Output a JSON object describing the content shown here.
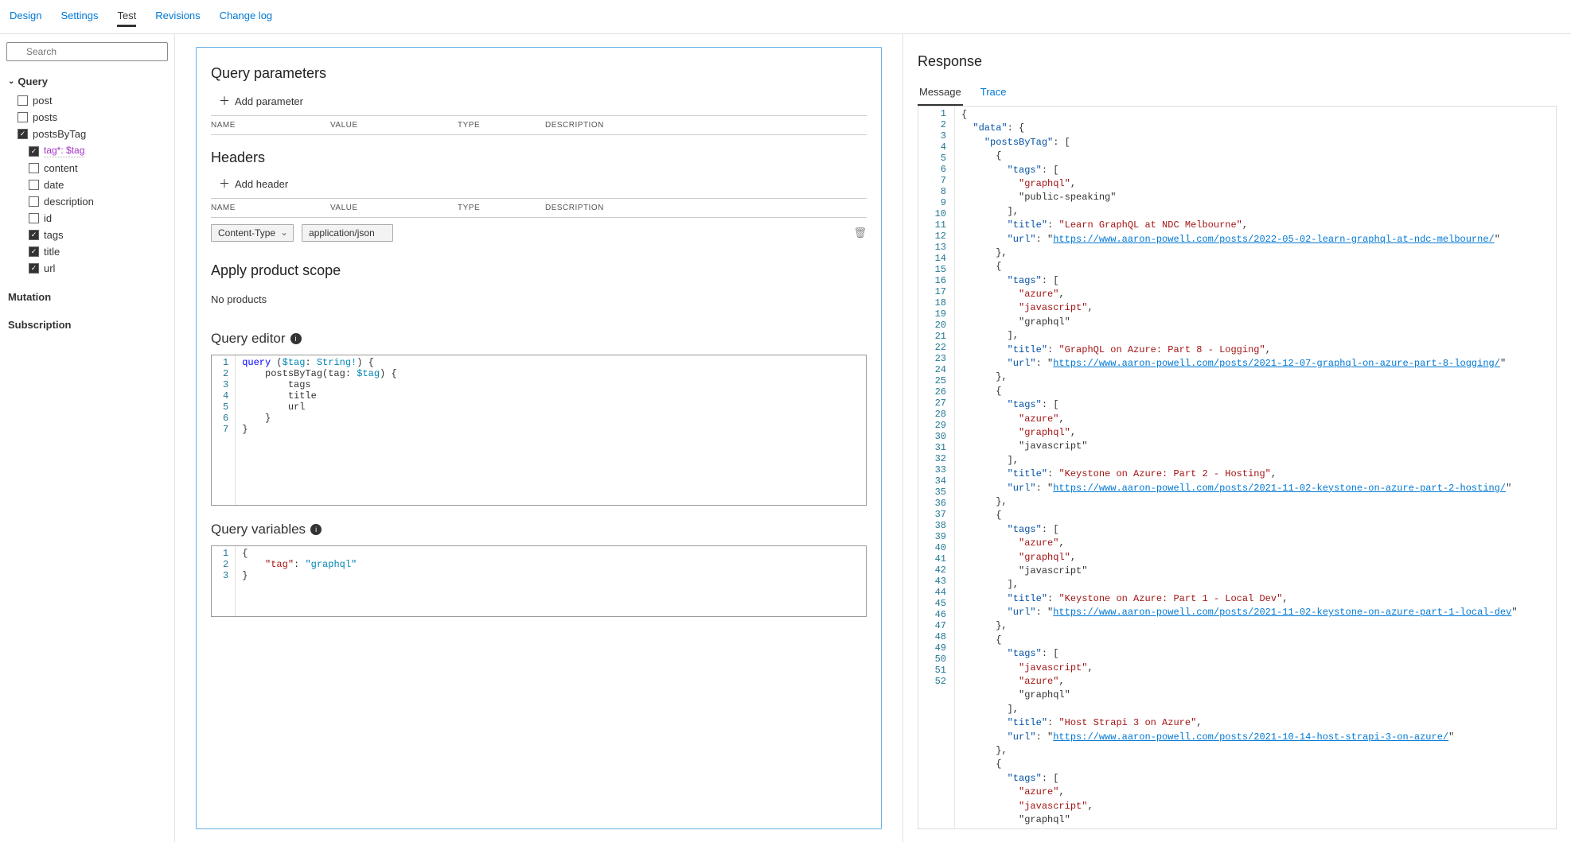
{
  "topTabs": [
    "Design",
    "Settings",
    "Test",
    "Revisions",
    "Change log"
  ],
  "search": {
    "placeholder": "Search"
  },
  "tree": {
    "rootQuery": "Query",
    "queryItems": [
      {
        "label": "post",
        "checked": false
      },
      {
        "label": "posts",
        "checked": false
      },
      {
        "label": "postsByTag",
        "checked": true,
        "children": [
          {
            "label": "tag*: $tag",
            "checked": true,
            "isParam": true
          },
          {
            "label": "content",
            "checked": false
          },
          {
            "label": "date",
            "checked": false
          },
          {
            "label": "description",
            "checked": false
          },
          {
            "label": "id",
            "checked": false
          },
          {
            "label": "tags",
            "checked": true
          },
          {
            "label": "title",
            "checked": true
          },
          {
            "label": "url",
            "checked": true
          }
        ]
      }
    ],
    "mutation": "Mutation",
    "subscription": "Subscription"
  },
  "center": {
    "queryParamsHeading": "Query parameters",
    "addParam": "Add parameter",
    "cols": {
      "name": "NAME",
      "value": "VALUE",
      "type": "TYPE",
      "desc": "DESCRIPTION"
    },
    "headersHeading": "Headers",
    "addHeader": "Add header",
    "headerRow": {
      "name": "Content-Type",
      "value": "application/json"
    },
    "applyScope": "Apply product scope",
    "noProducts": "No products",
    "queryEditor": "Query editor",
    "queryLines": [
      "query ($tag: String!) {",
      "    postsByTag(tag: $tag) {",
      "        tags",
      "        title",
      "        url",
      "    }",
      "}"
    ],
    "queryVariables": "Query variables",
    "varLines": [
      "{",
      "    \"tag\": \"graphql\"",
      "}"
    ]
  },
  "response": {
    "heading": "Response",
    "tabs": [
      "Message",
      "Trace"
    ],
    "lines": [
      "{",
      "  \"data\": {",
      "    \"postsByTag\": [",
      "      {",
      "        \"tags\": [",
      "          \"graphql\",",
      "          \"public-speaking\"",
      "        ],",
      "        \"title\": \"Learn GraphQL at NDC Melbourne\",",
      "        \"url\": \"https://www.aaron-powell.com/posts/2022-05-02-learn-graphql-at-ndc-melbourne/\"",
      "      },",
      "      {",
      "        \"tags\": [",
      "          \"azure\",",
      "          \"javascript\",",
      "          \"graphql\"",
      "        ],",
      "        \"title\": \"GraphQL on Azure: Part 8 - Logging\",",
      "        \"url\": \"https://www.aaron-powell.com/posts/2021-12-07-graphql-on-azure-part-8-logging/\"",
      "      },",
      "      {",
      "        \"tags\": [",
      "          \"azure\",",
      "          \"graphql\",",
      "          \"javascript\"",
      "        ],",
      "        \"title\": \"Keystone on Azure: Part 2 - Hosting\",",
      "        \"url\": \"https://www.aaron-powell.com/posts/2021-11-02-keystone-on-azure-part-2-hosting/\"",
      "      },",
      "      {",
      "        \"tags\": [",
      "          \"azure\",",
      "          \"graphql\",",
      "          \"javascript\"",
      "        ],",
      "        \"title\": \"Keystone on Azure: Part 1 - Local Dev\",",
      "        \"url\": \"https://www.aaron-powell.com/posts/2021-11-02-keystone-on-azure-part-1-local-dev\"",
      "      },",
      "      {",
      "        \"tags\": [",
      "          \"javascript\",",
      "          \"azure\",",
      "          \"graphql\"",
      "        ],",
      "        \"title\": \"Host Strapi 3 on Azure\",",
      "        \"url\": \"https://www.aaron-powell.com/posts/2021-10-14-host-strapi-3-on-azure/\"",
      "      },",
      "      {",
      "        \"tags\": [",
      "          \"azure\",",
      "          \"javascript\",",
      "          \"graphql\""
    ]
  }
}
